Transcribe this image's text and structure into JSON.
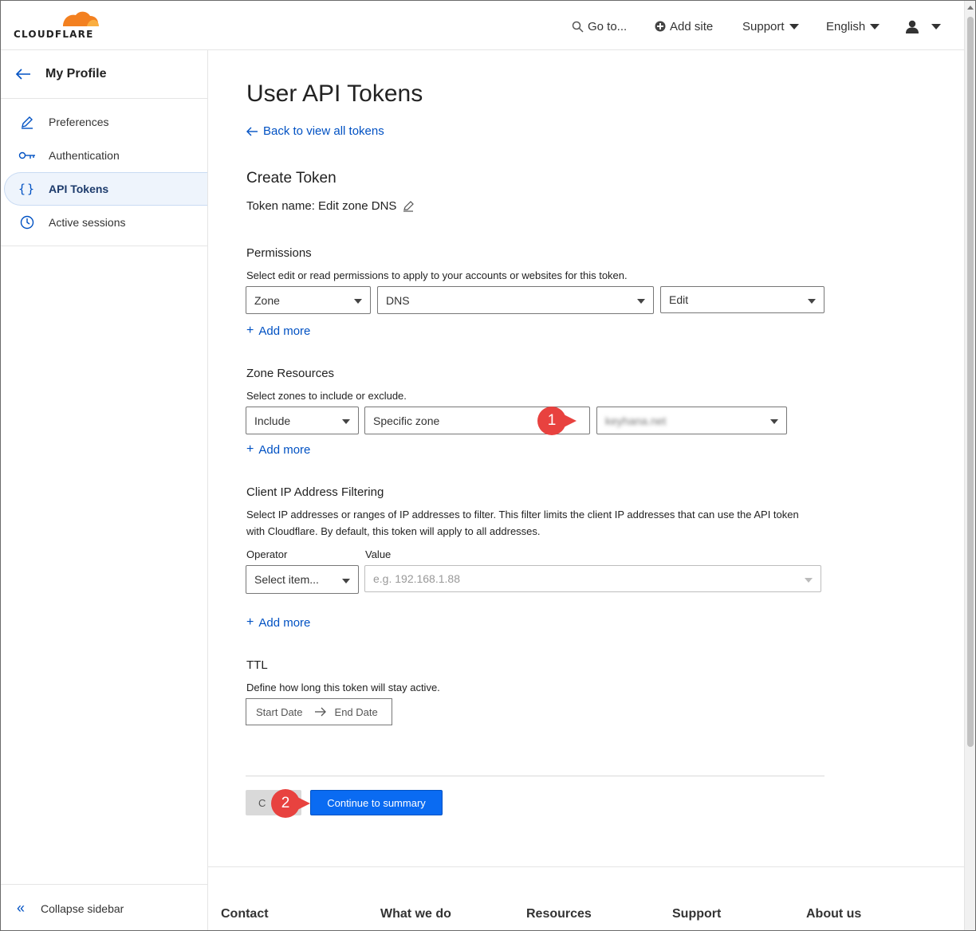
{
  "topbar": {
    "logo_text": "CLOUDFLARE",
    "goto_label": "Go to...",
    "add_site_label": "Add site",
    "support_label": "Support",
    "language_label": "English"
  },
  "sidebar": {
    "title": "My Profile",
    "items": [
      {
        "label": "Preferences",
        "icon": "pencil-icon"
      },
      {
        "label": "Authentication",
        "icon": "key-icon"
      },
      {
        "label": "API Tokens",
        "icon": "braces-icon"
      },
      {
        "label": "Active sessions",
        "icon": "clock-icon"
      }
    ],
    "active_index": 2,
    "collapse_label": "Collapse sidebar"
  },
  "main": {
    "page_title": "User API Tokens",
    "back_link": "Back to view all tokens",
    "section_title": "Create Token",
    "token_name": "Token name: Edit zone DNS",
    "permissions": {
      "label": "Permissions",
      "description": "Select edit or read permissions to apply to your accounts or websites for this token.",
      "select1": "Zone",
      "select2": "DNS",
      "select3": "Edit",
      "add_more": "Add more"
    },
    "zone_resources": {
      "label": "Zone Resources",
      "description": "Select zones to include or exclude.",
      "select1": "Include",
      "select2": "Specific zone",
      "select3": "keyhana.net",
      "add_more": "Add more"
    },
    "ip_filtering": {
      "label": "Client IP Address Filtering",
      "description": "Select IP addresses or ranges of IP addresses to filter. This filter limits the client IP addresses that can use the API token with Cloudflare. By default, this token will apply to all addresses.",
      "operator_label": "Operator",
      "value_label": "Value",
      "operator_select": "Select item...",
      "value_placeholder": "e.g. 192.168.1.88",
      "add_more": "Add more"
    },
    "ttl": {
      "label": "TTL",
      "description": "Define how long this token will stay active.",
      "start_date": "Start Date",
      "end_date": "End Date"
    },
    "buttons": {
      "cancel": "C",
      "continue": "Continue to summary"
    },
    "annotations": {
      "badge1": "1",
      "badge2": "2",
      "badge_color": "#e8423f"
    }
  },
  "footer": {
    "columns": [
      "Contact",
      "What we do",
      "Resources",
      "Support",
      "About us"
    ]
  },
  "colors": {
    "accent": "#0051c3",
    "button_primary": "#0a6bf2",
    "logo_orange": "#f38020",
    "logo_light": "#faae40"
  }
}
